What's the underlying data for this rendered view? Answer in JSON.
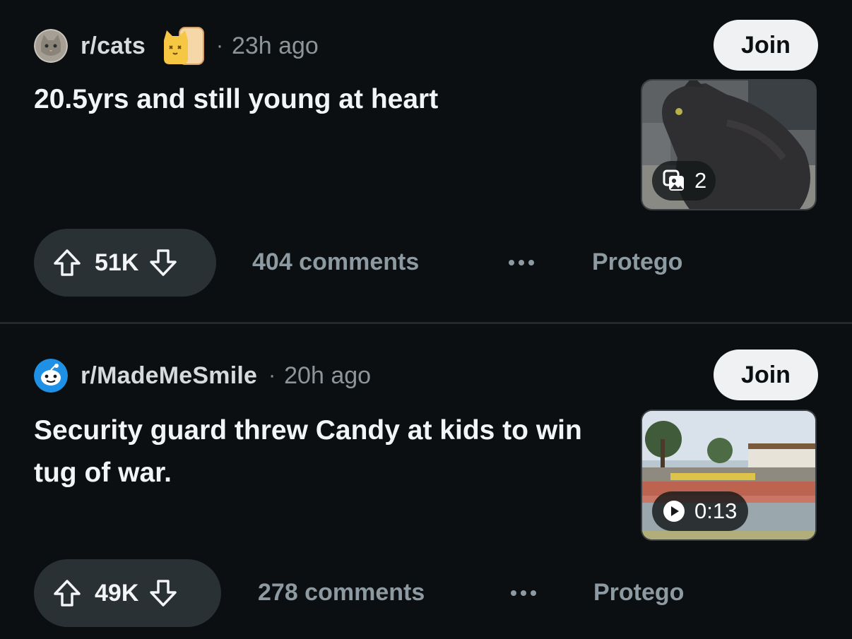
{
  "posts": [
    {
      "subreddit": "r/cats",
      "separator": "·",
      "age": "23h ago",
      "join_label": "Join",
      "title": "20.5yrs and still young at heart",
      "thumbnail": {
        "kind": "gallery",
        "badge_icon": "gallery-icon",
        "badge_text": "2"
      },
      "votes": "51K",
      "comments": "404 comments",
      "more_icon": "more-horizontal-icon",
      "protego_label": "Protego"
    },
    {
      "subreddit": "r/MadeMeSmile",
      "separator": "·",
      "age": "20h ago",
      "join_label": "Join",
      "title": "Security guard threw Candy at kids to win tug of war.",
      "thumbnail": {
        "kind": "video",
        "badge_icon": "play-icon",
        "badge_text": "0:13"
      },
      "votes": "49K",
      "comments": "278 comments",
      "more_icon": "more-horizontal-icon",
      "protego_label": "Protego"
    }
  ],
  "colors": {
    "background": "#0b0f11",
    "pill": "#2a3135",
    "join_bg": "#eff1f2",
    "muted_text": "#8e9aa1"
  }
}
